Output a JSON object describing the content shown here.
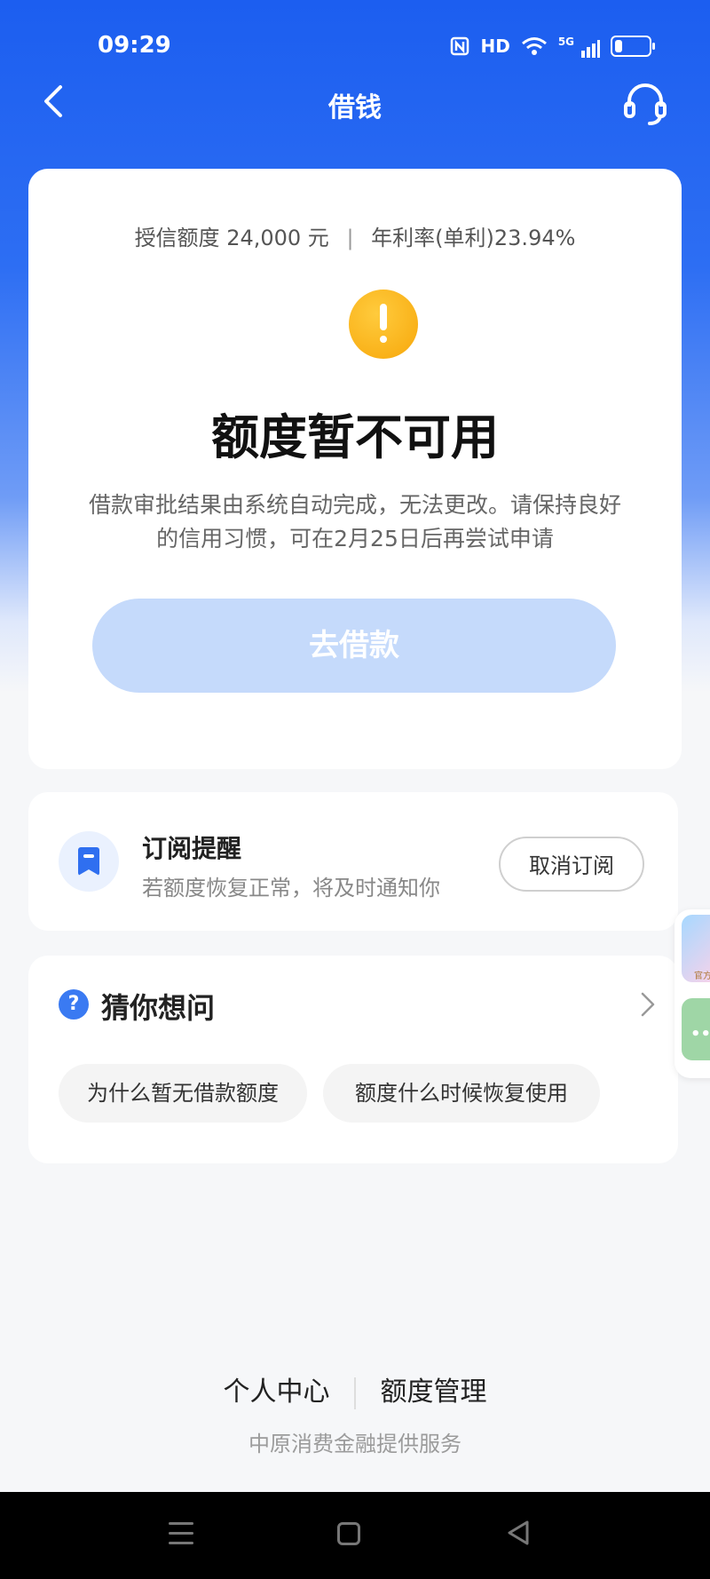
{
  "status_bar": {
    "time": "09:29",
    "icons": [
      "nfc-icon",
      "hd-icon",
      "wifi-icon",
      "5g-signal-icon",
      "battery-icon"
    ],
    "hd_label": "HD",
    "network_label": "5G"
  },
  "nav": {
    "title": "借钱",
    "back_icon": "chevron-left-icon",
    "service_icon": "headset-icon"
  },
  "credit": {
    "limit_text": "授信额度 24,000 元",
    "separator": "|",
    "rate_text": "年利率(单利)23.94%"
  },
  "status": {
    "icon": "warning-icon",
    "heading": "额度暂不可用",
    "description": "借款审批结果由系统自动完成，无法更改。请保持良好的信用习惯，可在2月25日后再尝试申请",
    "button_label": "去借款"
  },
  "subscription": {
    "icon": "bookmark-icon",
    "title": "订阅提醒",
    "description": "若额度恢复正常，将及时通知你",
    "button_label": "取消订阅"
  },
  "faq": {
    "icon": "question-icon",
    "title": "猜你想问",
    "arrow_icon": "chevron-right-icon",
    "questions": [
      "为什么暂无借款额度",
      "额度什么时候恢复使用"
    ]
  },
  "floating": {
    "top_label": "官方",
    "chat_icon": "chat-dots-icon"
  },
  "footer": {
    "links": [
      "个人中心",
      "额度管理"
    ],
    "provider": "中原消费金融提供服务"
  },
  "system_nav": {
    "icons": [
      "menu-icon",
      "home-icon",
      "back-triangle-icon"
    ]
  },
  "colors": {
    "brand_blue": "#1c5ef0",
    "warning": "#f7a70a",
    "disabled_button": "#c5dafb"
  }
}
